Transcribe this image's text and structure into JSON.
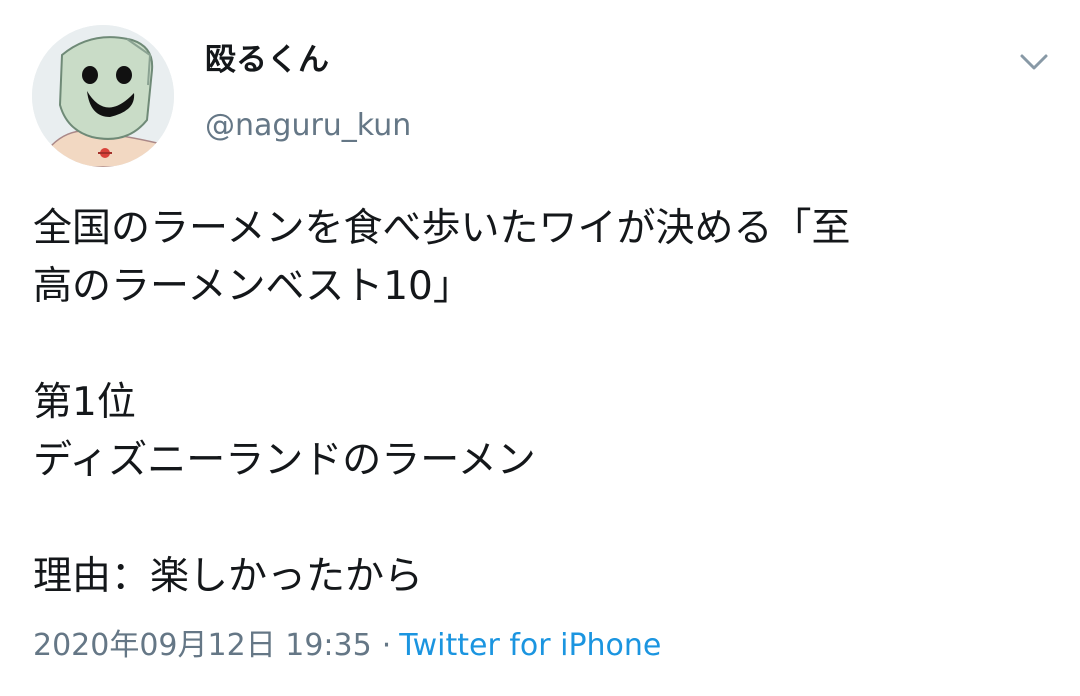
{
  "tweet": {
    "author": {
      "display_name": "殴るくん",
      "handle": "@naguru_kun"
    },
    "menu_icon": "chevron-down-icon",
    "body": {
      "line1": "全国のラーメンを食べ歩いたワイが決める「至",
      "line2": "高のラーメンベスト10」",
      "line3": "第1位",
      "line4": "ディズニーランドのラーメン",
      "line5": "理由：楽しかったから"
    },
    "timestamp": "2020年09月12日 19:35",
    "separator": "·",
    "source": "Twitter for iPhone"
  },
  "colors": {
    "text": "#14171a",
    "secondary": "#657786",
    "link": "#1b95e0"
  }
}
